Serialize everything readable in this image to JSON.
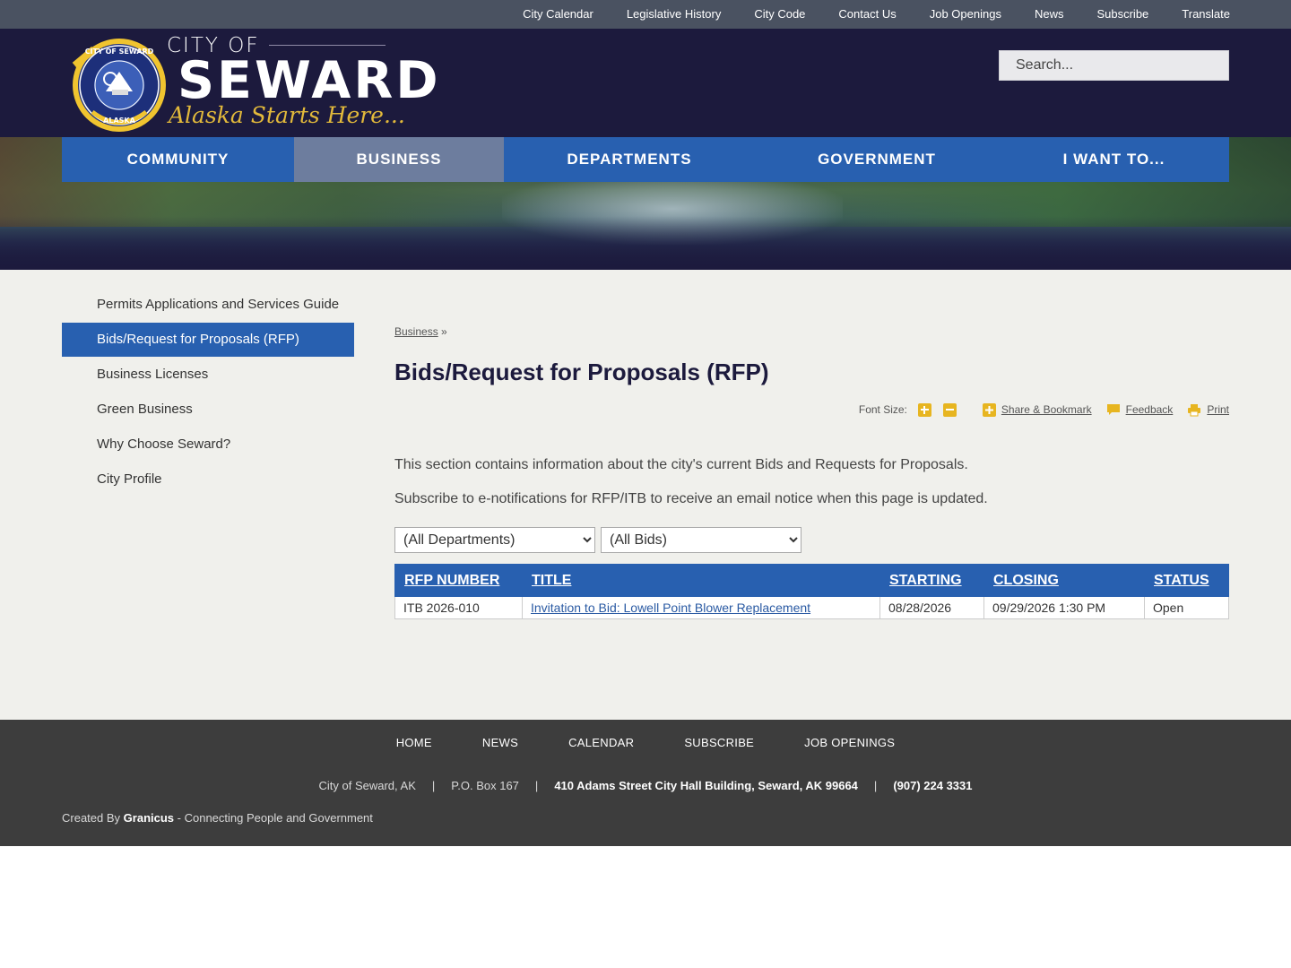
{
  "utility_nav": [
    "City Calendar",
    "Legislative History",
    "City Code",
    "Contact Us",
    "Job Openings",
    "News",
    "Subscribe",
    "Translate"
  ],
  "logo": {
    "city_of": "CITY OF",
    "name": "SEWARD",
    "tagline": "Alaska Starts Here...",
    "seal_text_top": "CITY OF SEWARD",
    "seal_text_bottom": "ALASKA"
  },
  "search": {
    "placeholder": "Search..."
  },
  "main_nav": [
    {
      "label": "COMMUNITY",
      "active": false
    },
    {
      "label": "BUSINESS",
      "active": true
    },
    {
      "label": "DEPARTMENTS",
      "active": false
    },
    {
      "label": "GOVERNMENT",
      "active": false
    },
    {
      "label": "I WANT TO...",
      "active": false
    }
  ],
  "sidebar": {
    "items": [
      {
        "label": "Permits Applications and Services Guide",
        "active": false
      },
      {
        "label": "Bids/Request for Proposals (RFP)",
        "active": true
      },
      {
        "label": "Business Licenses",
        "active": false
      },
      {
        "label": "Green Business",
        "active": false
      },
      {
        "label": "Why Choose Seward?",
        "active": false
      },
      {
        "label": "City Profile",
        "active": false
      }
    ]
  },
  "breadcrumb": {
    "link": "Business",
    "separator": "»"
  },
  "page": {
    "title": "Bids/Request for Proposals (RFP)",
    "intro_1": "This section contains information about the city's current Bids and Requests for Proposals.",
    "intro_2": "Subscribe to e-notifications for RFP/ITB to receive an email notice when this page is updated."
  },
  "tools": {
    "font_size_label": "Font Size:",
    "share": "Share & Bookmark",
    "feedback": "Feedback",
    "print": "Print"
  },
  "filters": {
    "department": "(All Departments)",
    "bids": "(All Bids)"
  },
  "table": {
    "headers": [
      "RFP NUMBER",
      "TITLE",
      "STARTING",
      "CLOSING",
      "STATUS"
    ],
    "rows": [
      [
        "ITB 2026-010",
        "Invitation to Bid: Lowell Point Blower Replacement",
        "08/28/2026",
        "09/29/2026 1:30 PM",
        "Open"
      ]
    ]
  },
  "footer": {
    "nav": [
      "HOME",
      "NEWS",
      "CALENDAR",
      "SUBSCRIBE",
      "JOB OPENINGS"
    ],
    "address": {
      "city": "City of Seward, AK",
      "po_box": "P.O. Box 167",
      "street": "410 Adams Street City Hall Building, Seward, AK 99664",
      "phone": "(907) 224 3331",
      "separator": "|"
    },
    "credit": {
      "prefix": "Created By",
      "brand": "Granicus",
      "suffix": "- Connecting People and Government"
    }
  },
  "colors": {
    "header_bg": "#1c1a3d",
    "nav_blue": "#2860b0",
    "nav_active": "#6d7d9e",
    "accent_gold": "#e7b520",
    "footer_bg": "#3d3d3d",
    "content_bg": "#f0f0ec"
  }
}
